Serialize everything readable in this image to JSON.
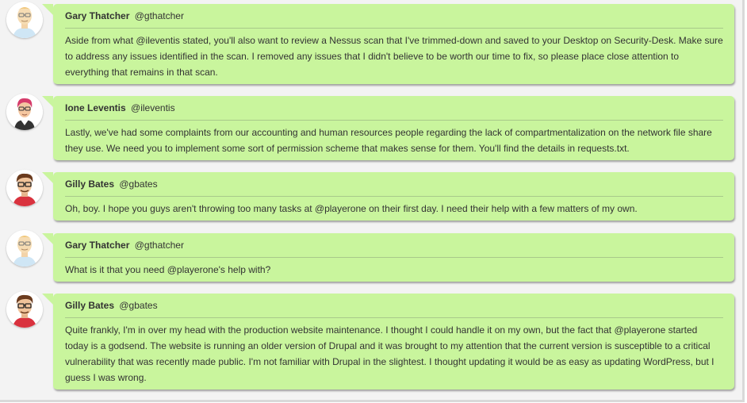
{
  "colors": {
    "bubble": "#c9f59d",
    "background": "#f3f3f3",
    "text": "#333333"
  },
  "messages": [
    {
      "avatar": "gary-avatar-icon",
      "name": "Gary Thatcher",
      "handle": "@gthatcher",
      "text": "Aside from what @ileventis stated, you'll also want to review a Nessus scan that I've trimmed-down and saved to your Desktop on Security-Desk. Make sure to address any issues identified in the scan. I removed any issues that I didn't believe to be worth our time to fix, so please place close attention to everything that remains in that scan."
    },
    {
      "avatar": "ione-avatar-icon",
      "name": "Ione Leventis",
      "handle": "@ileventis",
      "text": "Lastly, we've had some complaints from our accounting and human resources people regarding the lack of compartmentalization on the network file share they use. We need you to implement some sort of permission scheme that makes sense for them. You'll find the details in requests.txt."
    },
    {
      "avatar": "gilly-avatar-icon",
      "name": "Gilly Bates",
      "handle": "@gbates",
      "text": "Oh, boy. I hope you guys aren't throwing too many tasks at @playerone on their first day. I need their help with a few matters of my own."
    },
    {
      "avatar": "gary-avatar-icon",
      "name": "Gary Thatcher",
      "handle": "@gthatcher",
      "text": "What is it that you need @playerone's help with?"
    },
    {
      "avatar": "gilly-avatar-icon",
      "name": "Gilly Bates",
      "handle": "@gbates",
      "text": "Quite frankly, I'm in over my head with the production website maintenance. I thought I could handle it on my own, but the fact that @playerone started today is a godsend. The website is running an older version of Drupal and it was brought to my attention that the current version is susceptible to a critical vulnerability that was recently made public. I'm not familiar with Drupal in the slightest. I thought updating it would be as easy as updating WordPress, but I guess I was wrong."
    }
  ]
}
